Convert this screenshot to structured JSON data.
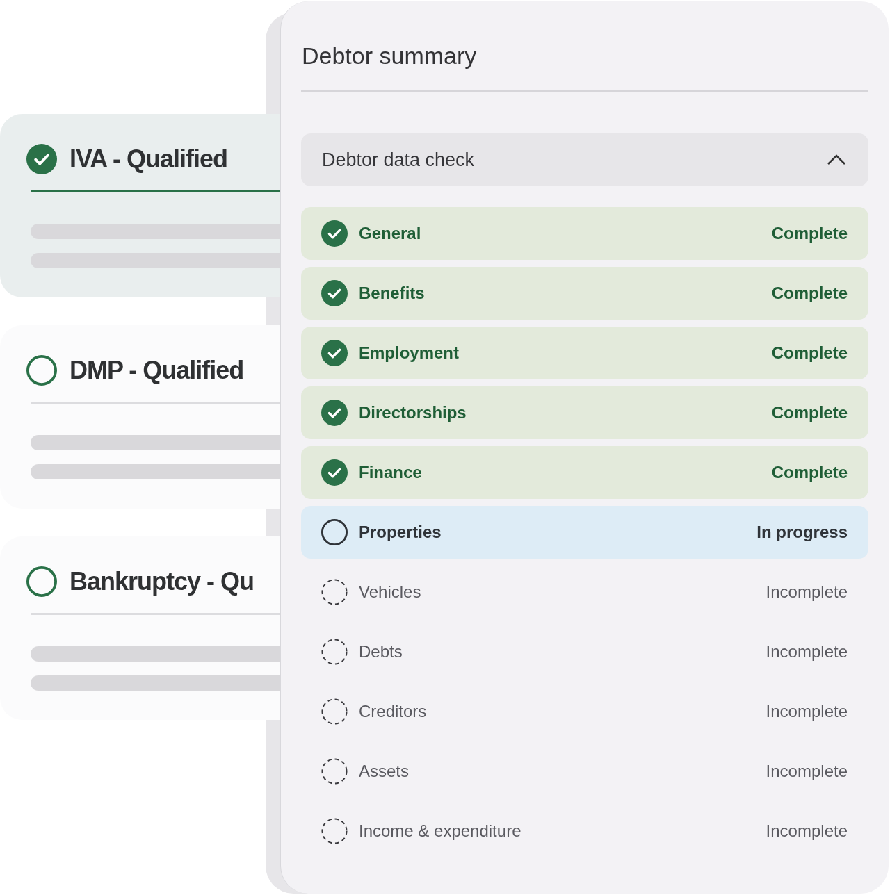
{
  "qualifications": [
    {
      "title": "IVA - Qualified",
      "selected": true
    },
    {
      "title": "DMP - Qualified",
      "selected": false
    },
    {
      "title": "Bankruptcy - Qu",
      "selected": false
    }
  ],
  "panel": {
    "title": "Debtor summary",
    "section": {
      "title": "Debtor data check",
      "expanded": true
    },
    "items": [
      {
        "label": "General",
        "status": "Complete",
        "kind": "complete"
      },
      {
        "label": "Benefits",
        "status": "Complete",
        "kind": "complete"
      },
      {
        "label": "Employment",
        "status": "Complete",
        "kind": "complete"
      },
      {
        "label": "Directorships",
        "status": "Complete",
        "kind": "complete"
      },
      {
        "label": "Finance",
        "status": "Complete",
        "kind": "complete"
      },
      {
        "label": "Properties",
        "status": "In progress",
        "kind": "in_progress"
      },
      {
        "label": "Vehicles",
        "status": "Incomplete",
        "kind": "incomplete"
      },
      {
        "label": "Debts",
        "status": "Incomplete",
        "kind": "incomplete"
      },
      {
        "label": "Creditors",
        "status": "Incomplete",
        "kind": "incomplete"
      },
      {
        "label": "Assets",
        "status": "Incomplete",
        "kind": "incomplete"
      },
      {
        "label": "Income & expenditure",
        "status": "Incomplete",
        "kind": "incomplete"
      }
    ]
  }
}
